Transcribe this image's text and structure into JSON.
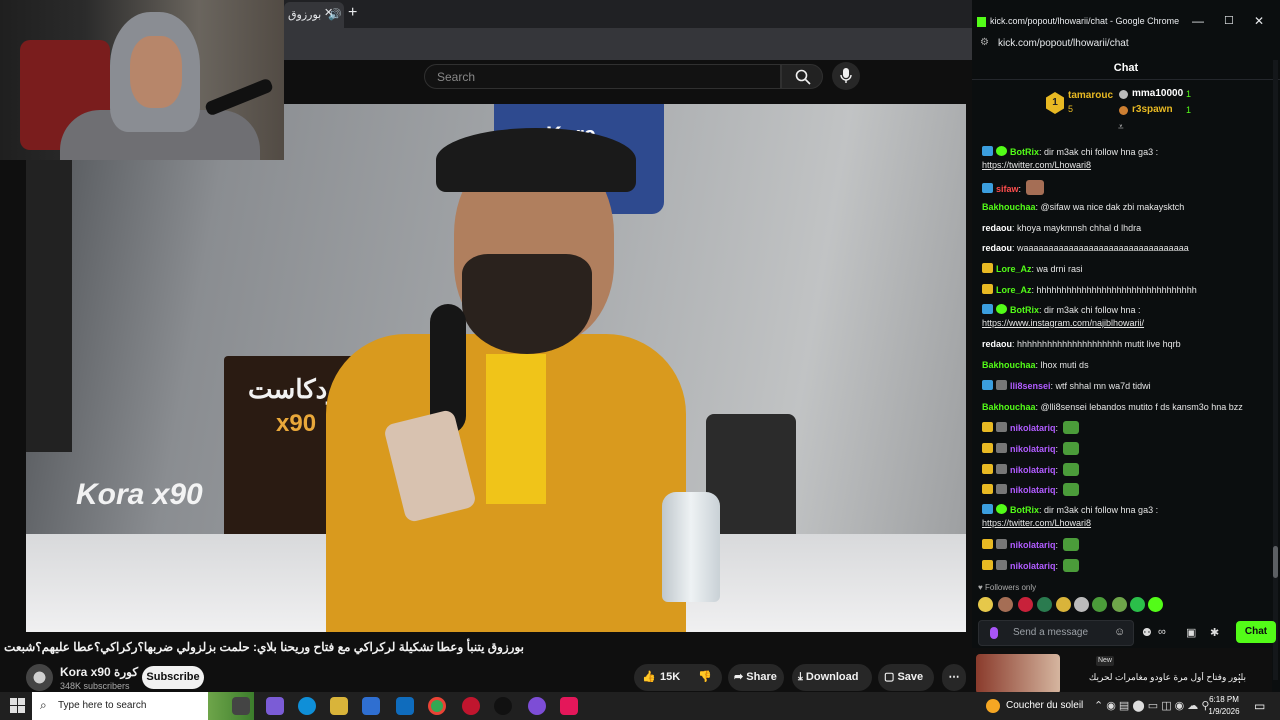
{
  "youtube": {
    "tab_title": "بورزوق",
    "search_placeholder": "Search",
    "video_title": "بورزوق يتنبأ وعطا تشكيلة لركراكي مع فتاح وريحنا بلاي: حلمت بزلزولي ضربها؟ركراكي؟عطا عليهم؟شبعت بسبان؟",
    "poster_text": "بودكاست",
    "poster_x90": "x90",
    "sign_text": "Kora",
    "logo_text": "Kora x90",
    "channel": {
      "name": "Kora x90 كورة",
      "subscribers": "348K subscribers"
    },
    "subscribe_label": "Subscribe",
    "like_count": "15K",
    "share_label": "Share",
    "download_label": "Download",
    "save_label": "Save"
  },
  "kick": {
    "window_title": "kick.com/popout/lhowarii/chat - Google Chrome",
    "url": "kick.com/popout/lhowarii/chat",
    "chat_header": "Chat",
    "leaderboard": [
      {
        "rank": "1",
        "name": "tamarouc",
        "count": "5"
      },
      {
        "name": "mma10000",
        "count": "1"
      },
      {
        "name": "r3spawn",
        "count": "1"
      }
    ],
    "messages": [
      {
        "user": "BotRix",
        "color": "#53fc18",
        "badges": [
          "bot",
          "ver"
        ],
        "text": "dir m3ak chi follow hna ga3 :",
        "link": "https://twitter.com/Lhowari8"
      },
      {
        "user": "sifaw",
        "color": "#ff4d4d",
        "badges": [
          "bot"
        ],
        "text": "",
        "emote": "face"
      },
      {
        "user": "Bakhouchaa",
        "color": "#53fc18",
        "badges": [],
        "text": "@sifaw wa nice dak zbi makaysktch"
      },
      {
        "user": "redaou",
        "color": "#ffffff",
        "badges": [],
        "text": "khoya maykmnsh chhal d lhdra"
      },
      {
        "user": "redaou",
        "color": "#ffffff",
        "badges": [],
        "text": "waaaaaaaaaaaaaaaaaaaaaaaaaaaaaaaaa"
      },
      {
        "user": "Lore_Az",
        "color": "#53fc18",
        "badges": [
          "crown"
        ],
        "text": "wa drni rasi"
      },
      {
        "user": "Lore_Az",
        "color": "#53fc18",
        "badges": [
          "crown"
        ],
        "text": "hhhhhhhhhhhhhhhhhhhhhhhhhhhhhhhh"
      },
      {
        "user": "BotRix",
        "color": "#53fc18",
        "badges": [
          "bot",
          "ver"
        ],
        "text": "dir m3ak chi follow hna :",
        "link": "https://www.instagram.com/najiblhowarii/"
      },
      {
        "user": "redaou",
        "color": "#ffffff",
        "badges": [],
        "text": "hhhhhhhhhhhhhhhhhhhhh mutit live hqrb"
      },
      {
        "user": "Bakhouchaa",
        "color": "#53fc18",
        "badges": [],
        "text": "lhox muti ds"
      },
      {
        "user": "lli8sensei",
        "color": "#b15cff",
        "badges": [
          "bot",
          "grey"
        ],
        "text": "wtf shhal mn wa7d tidwi"
      },
      {
        "user": "Bakhouchaa",
        "color": "#53fc18",
        "badges": [],
        "text": "@lli8sensei lebandos mutito f ds kansm3o hna bzz"
      },
      {
        "user": "nikolatariq",
        "color": "#b15cff",
        "badges": [
          "crown",
          "grey"
        ],
        "text": "",
        "emote": "pepe"
      },
      {
        "user": "nikolatariq",
        "color": "#b15cff",
        "badges": [
          "crown",
          "grey"
        ],
        "text": "",
        "emote": "pepe"
      },
      {
        "user": "nikolatariq",
        "color": "#b15cff",
        "badges": [
          "crown",
          "grey"
        ],
        "text": "",
        "emote": "pepe"
      },
      {
        "user": "nikolatariq",
        "color": "#b15cff",
        "badges": [
          "crown",
          "grey"
        ],
        "text": "",
        "emote": "pepe"
      },
      {
        "user": "BotRix",
        "color": "#53fc18",
        "badges": [
          "bot",
          "ver"
        ],
        "text": "dir m3ak chi follow hna ga3 :",
        "link": "https://twitter.com/Lhowari8"
      },
      {
        "user": "nikolatariq",
        "color": "#b15cff",
        "badges": [
          "crown",
          "grey"
        ],
        "text": "",
        "emote": "pepe"
      },
      {
        "user": "nikolatariq",
        "color": "#b15cff",
        "badges": [
          "crown",
          "grey"
        ],
        "text": "",
        "emote": "pepe"
      }
    ],
    "followers_only": "Followers only",
    "input_placeholder": "Send a message",
    "send_label": "Chat",
    "recommendation": {
      "badge": "New",
      "title": "بلبور وفتاح أول مرة عاودو مغامرات لحريك"
    }
  },
  "taskbar": {
    "search_placeholder": "Type here to search",
    "weather": "Coucher du soleil",
    "time": "6:18 PM",
    "date": "1/9/2026"
  }
}
